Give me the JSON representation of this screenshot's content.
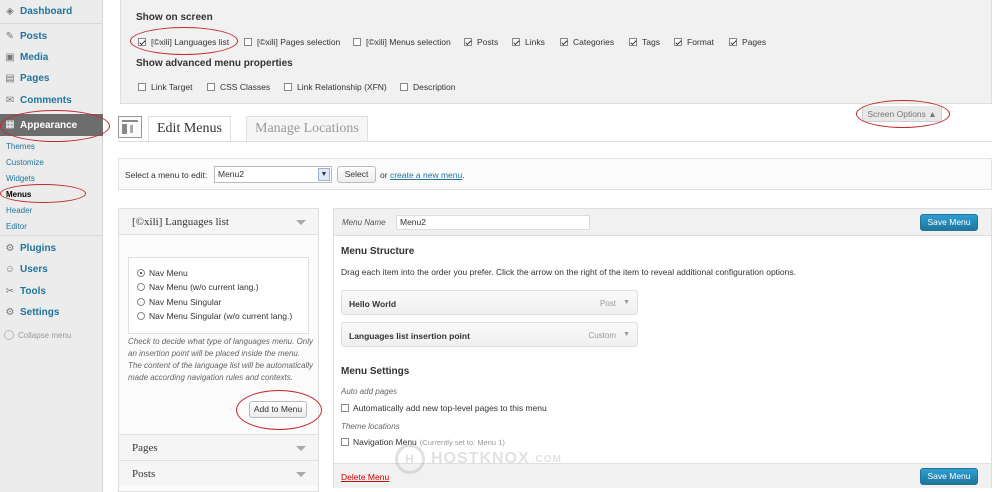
{
  "sidebar": {
    "items": [
      {
        "label": "Dashboard",
        "icon": "dashboard-icon",
        "glyph": "◈"
      },
      {
        "label": "Posts",
        "icon": "posts-icon",
        "glyph": "✎"
      },
      {
        "label": "Media",
        "icon": "media-icon",
        "glyph": "▣"
      },
      {
        "label": "Pages",
        "icon": "pages-icon",
        "glyph": "▤"
      },
      {
        "label": "Comments",
        "icon": "comments-icon",
        "glyph": "✉"
      },
      {
        "label": "Appearance",
        "icon": "appearance-icon",
        "glyph": "▦"
      },
      {
        "label": "Plugins",
        "icon": "plugins-icon",
        "glyph": "⚙"
      },
      {
        "label": "Users",
        "icon": "users-icon",
        "glyph": "☺"
      },
      {
        "label": "Tools",
        "icon": "tools-icon",
        "glyph": "✂"
      },
      {
        "label": "Settings",
        "icon": "settings-icon",
        "glyph": "⚙"
      }
    ],
    "submenu": [
      "Themes",
      "Customize",
      "Widgets",
      "Menus",
      "Header",
      "Editor"
    ],
    "current_submenu": "Menus",
    "collapse_label": "Collapse menu"
  },
  "screen_options": {
    "show_on_screen_title": "Show on screen",
    "show_on_screen": [
      {
        "label": "[©xili] Languages list",
        "checked": true
      },
      {
        "label": "[©xili] Pages selection",
        "checked": false
      },
      {
        "label": "[©xili] Menus selection",
        "checked": false
      },
      {
        "label": "Posts",
        "checked": true
      },
      {
        "label": "Links",
        "checked": true
      },
      {
        "label": "Categories",
        "checked": true
      },
      {
        "label": "Tags",
        "checked": true
      },
      {
        "label": "Format",
        "checked": true
      },
      {
        "label": "Pages",
        "checked": true
      }
    ],
    "advanced_title": "Show advanced menu properties",
    "advanced": [
      {
        "label": "Link Target",
        "checked": false
      },
      {
        "label": "CSS Classes",
        "checked": false
      },
      {
        "label": "Link Relationship (XFN)",
        "checked": false
      },
      {
        "label": "Description",
        "checked": false
      }
    ],
    "toggle_label": "Screen Options ▲"
  },
  "tabs": [
    {
      "label": "Edit Menus",
      "active": true
    },
    {
      "label": "Manage Locations",
      "active": false
    }
  ],
  "select_bar": {
    "label": "Select a menu to edit:",
    "selected_menu": "Menu2",
    "select_button": "Select",
    "or_text": "or",
    "create_link": "create a new menu",
    "period": "."
  },
  "languages_box": {
    "title": "[©xili] Languages list",
    "options": [
      {
        "label": "Nav Menu",
        "selected": true
      },
      {
        "label": "Nav Menu (w/o current lang.)",
        "selected": false
      },
      {
        "label": "Nav Menu Singular",
        "selected": false
      },
      {
        "label": "Nav Menu Singular (w/o current lang.)",
        "selected": false
      }
    ],
    "description": "Check to decide what type of languages menu. Only an insertion point will be placed inside the menu. The content of the language list will be automatically made according navigation rules and contexts.",
    "add_button": "Add to Menu",
    "sections": [
      "Pages",
      "Posts"
    ]
  },
  "editor": {
    "menu_name_label": "Menu Name",
    "menu_name_value": "Menu2",
    "save_label": "Save Menu",
    "structure_title": "Menu Structure",
    "structure_help": "Drag each item into the order you prefer. Click the arrow on the right of the item to reveal additional configuration options.",
    "items": [
      {
        "title": "Hello World",
        "type": "Post"
      },
      {
        "title": "Languages list insertion point",
        "type": "Custom"
      }
    ],
    "settings_title": "Menu Settings",
    "auto_add_label": "Auto add pages",
    "auto_add_option": "Automatically add new top-level pages to this menu",
    "theme_locations_label": "Theme locations",
    "theme_location_option": "Navigation Menu",
    "theme_location_note": "(Currently set to: Menu 1)",
    "delete_label": "Delete Menu"
  },
  "watermark": {
    "name": "HOSTKNOX",
    "suffix": ".COM"
  },
  "colors": {
    "link": "#21759b",
    "highlight_ring": "#c0282d",
    "primary_button": "#21759b",
    "current_menu": "#6d6d6d"
  }
}
